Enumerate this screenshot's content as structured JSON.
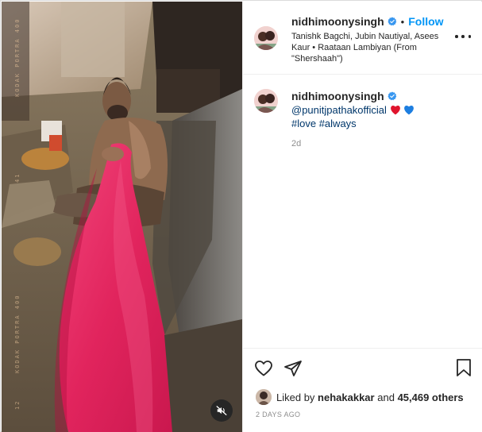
{
  "post": {
    "username": "nidhimoonysingh",
    "follow_label": "Follow",
    "separator": "•",
    "music_info": "Tanishk Bagchi, Jubin Nautiyal, Asees Kaur • Raataan Lambiyan (From \"Shershaah\")"
  },
  "caption": {
    "username": "nidhimoonysingh",
    "mention": "@punitjpathakofficial",
    "hashtag_love": "#love",
    "hashtag_always": "#always",
    "time": "2d"
  },
  "likes": {
    "prefix": "Liked by",
    "liked_user": "nehakakkar",
    "and": "and",
    "count": "45,469 others"
  },
  "post_date": "2 DAYS AGO",
  "media": {
    "film_text_top": "KODAK PORTRA 400",
    "film_text_mid": "41",
    "film_text_bottom": "KODAK PORTRA 400",
    "film_text_num": "12"
  },
  "icons": {
    "verified": "verified-badge-icon",
    "more": "more-options-icon",
    "like": "heart-outline-icon",
    "share": "paper-plane-icon",
    "save": "bookmark-icon",
    "mute": "speaker-muted-icon",
    "emoji_red": "red-heart-emoji",
    "emoji_blue": "blue-heart-emoji"
  },
  "colors": {
    "follow_blue": "#0095f6",
    "link_blue": "#00376b",
    "verified_blue": "#3897f0",
    "muted_gray": "#8e8e8e",
    "dupatta_pink": "#e8275f"
  }
}
